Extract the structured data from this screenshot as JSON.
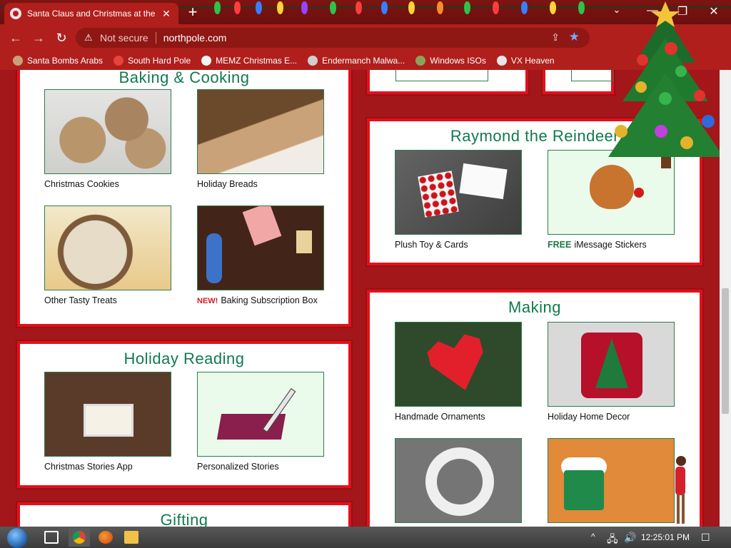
{
  "browser": {
    "tab_title": "Santa Claus and Christmas at the",
    "tab_close": "✕",
    "new_tab": "+",
    "minimize": "—",
    "restore": "❐",
    "close": "✕",
    "tab_list": "⌄",
    "back": "←",
    "forward": "→",
    "reload": "↻",
    "not_secure": "Not secure",
    "url": "northpole.com",
    "share_icon": "share-icon",
    "bookmark_star": "★",
    "menu": "⋮",
    "bookmarks": [
      {
        "label": "Santa Bombs Arabs",
        "icon_color": "#c8a07a"
      },
      {
        "label": "South Hard Pole",
        "icon_color": "#e3443c"
      },
      {
        "label": "MEMZ Christmas E...",
        "icon_color": "#f4f4f4"
      },
      {
        "label": "Endermanch Malwa...",
        "icon_color": "#cfcfcf"
      },
      {
        "label": "Windows ISOs",
        "icon_color": "#8aa35a"
      },
      {
        "label": "VX Heaven",
        "icon_color": "#e6e6e6"
      }
    ]
  },
  "sections": {
    "baking": {
      "title": "Baking & Cooking",
      "tiles": [
        {
          "caption": "Christmas Cookies"
        },
        {
          "caption": "Holiday Breads"
        },
        {
          "caption": "Other Tasty Treats"
        },
        {
          "badge": "NEW!",
          "caption": "Baking Subscription Box"
        }
      ]
    },
    "raymond": {
      "title": "Raymond the Reindeer",
      "tiles": [
        {
          "caption": "Plush Toy & Cards"
        },
        {
          "badge": "FREE",
          "caption": "iMessage Stickers"
        }
      ]
    },
    "reading": {
      "title": "Holiday Reading",
      "tiles": [
        {
          "caption": "Christmas Stories App"
        },
        {
          "caption": "Personalized Stories"
        }
      ]
    },
    "making": {
      "title": "Making",
      "tiles": [
        {
          "caption": "Handmade Ornaments"
        },
        {
          "caption": "Holiday Home Decor"
        }
      ]
    },
    "gifting": {
      "title": "Gifting"
    }
  },
  "taskbar": {
    "clock": "12:25:01 PM",
    "tray_chevron": "^",
    "notification": "☐"
  },
  "colors": {
    "section_title": "#107a4f",
    "panel_border": "#e3101b",
    "page_bg": "#a3161a",
    "new_badge": "#d01e2a",
    "free_badge": "#1b7c3f"
  }
}
